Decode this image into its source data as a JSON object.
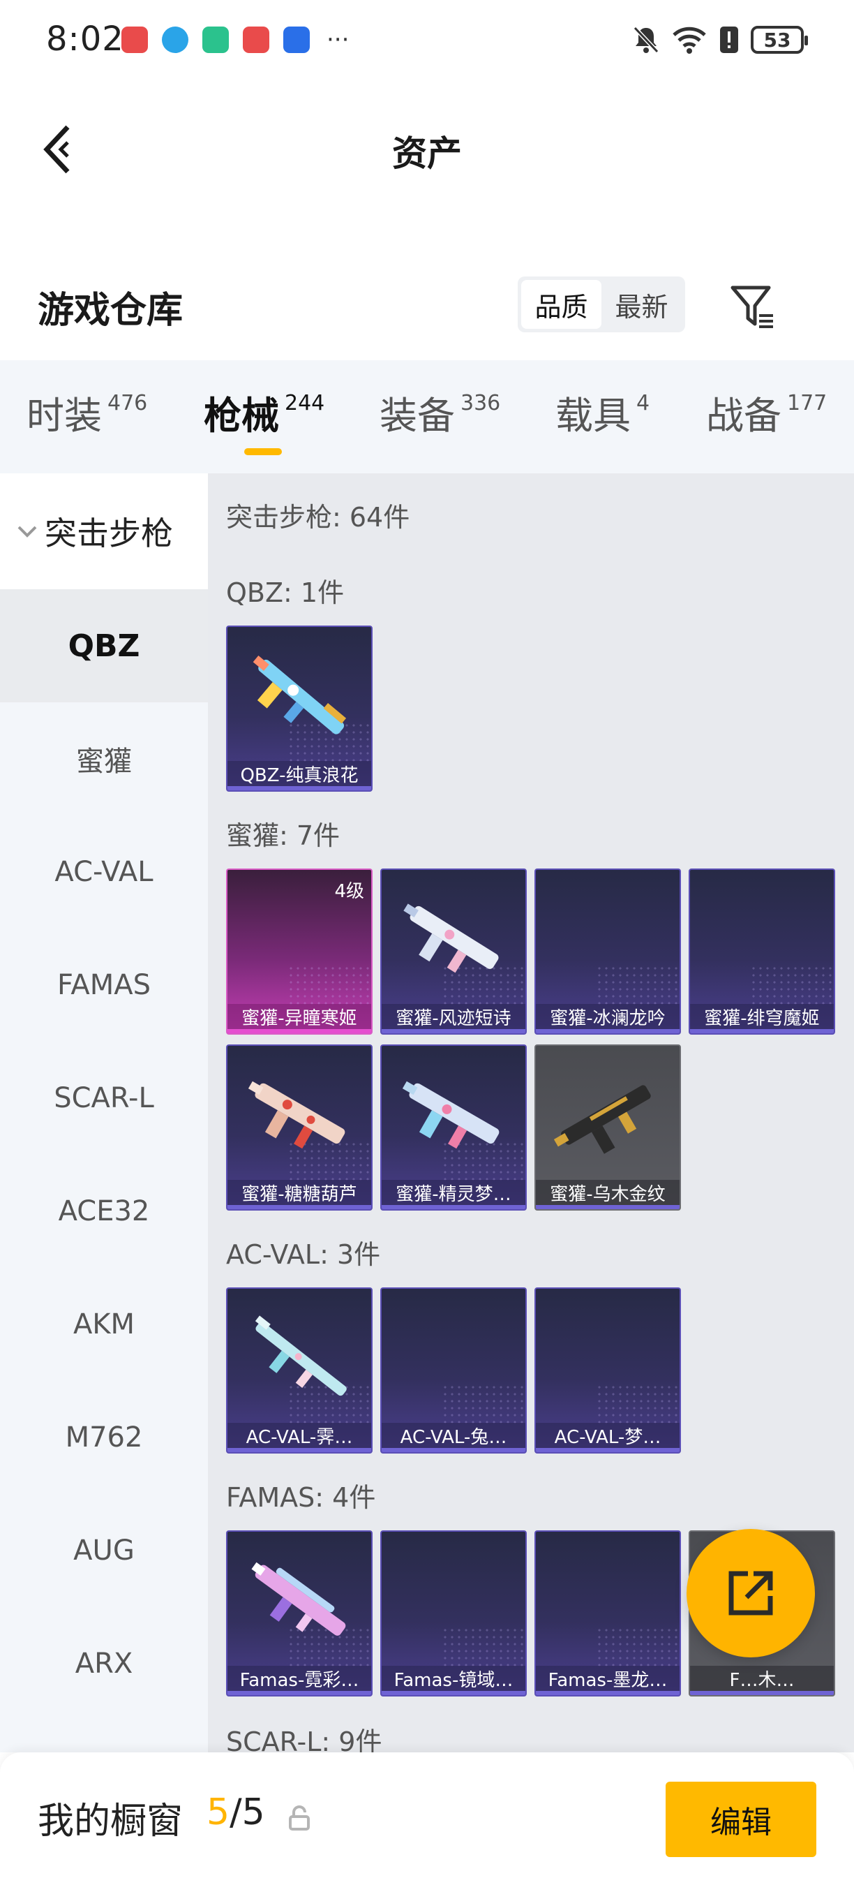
{
  "status": {
    "time": "8:02",
    "battery": "53"
  },
  "header": {
    "title": "资产"
  },
  "warehouse": {
    "title": "游戏仓库",
    "sort_options": [
      "品质",
      "最新"
    ],
    "sort_selected": "品质"
  },
  "tabs": [
    {
      "label": "时装",
      "count": "476"
    },
    {
      "label": "枪械",
      "count": "244"
    },
    {
      "label": "装备",
      "count": "336"
    },
    {
      "label": "载具",
      "count": "4"
    },
    {
      "label": "战备",
      "count": "177"
    }
  ],
  "side": {
    "group": "突击步枪",
    "items": [
      "QBZ",
      "蜜獾",
      "AC-VAL",
      "FAMAS",
      "SCAR-L",
      "ACE32",
      "AKM",
      "M762",
      "AUG",
      "ARX"
    ]
  },
  "main": {
    "category_title": "突击步枪: 64件",
    "sections": [
      {
        "title": "QBZ: 1件",
        "items": [
          "QBZ-纯真浪花"
        ]
      },
      {
        "title": "蜜獾: 7件",
        "items": [
          "蜜獾-异瞳寒姬",
          "蜜獾-风迹短诗",
          "蜜獾-冰澜龙吟",
          "蜜獾-绯穹魔姬",
          "蜜獾-糖糖葫芦",
          "蜜獾-精灵梦…",
          "蜜獾-乌木金纹"
        ],
        "level_badge": "4级"
      },
      {
        "title": "AC-VAL: 3件",
        "items": [
          "AC-VAL-霁…",
          "AC-VAL-兔…",
          "AC-VAL-梦…"
        ]
      },
      {
        "title": "FAMAS: 4件",
        "items": [
          "Famas-霓彩…",
          "Famas-镜域…",
          "Famas-墨龙…",
          "F…木…"
        ]
      },
      {
        "title": "SCAR-L: 9件"
      }
    ]
  },
  "bottom": {
    "label": "我的橱窗",
    "count_current": "5",
    "count_sep": "/5",
    "edit": "编辑"
  },
  "colors": {
    "accent": "#ffb900",
    "card_purple": "#4b3f8e",
    "card_pink": "#c63fb5"
  }
}
